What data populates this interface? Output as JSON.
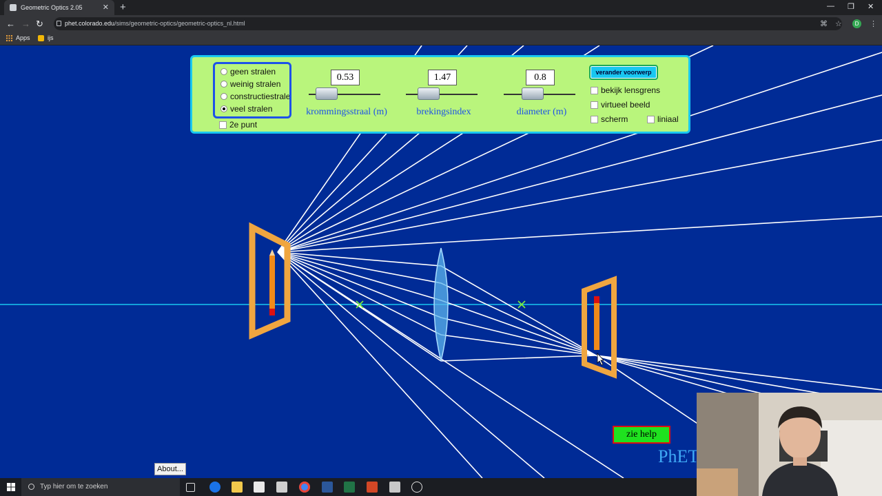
{
  "browser": {
    "tab_title": "Geometric Optics 2.05",
    "url_host": "phet.colorado.edu",
    "url_path": "/sims/geometric-optics/geometric-optics_nl.html",
    "bookmarks": [
      "Apps",
      "ijs"
    ],
    "profile_initial": "D"
  },
  "sim": {
    "ray_options": [
      "geen stralen",
      "weinig stralen",
      "constructiestralen",
      "veel stralen"
    ],
    "selected_ray_option": "veel stralen",
    "second_point_label": "2e punt",
    "sliders": [
      {
        "label": "krommingsstraal (m)",
        "value": "0.53",
        "level": 0.35
      },
      {
        "label": "brekingsindex",
        "value": "1.47",
        "level": 0.4
      },
      {
        "label": "diameter (m)",
        "value": "0.8",
        "level": 0.55
      }
    ],
    "change_object_label": "verander voorwerp",
    "checkboxes": [
      "bekijk lensgrens",
      "virtueel beeld",
      "scherm",
      "liniaal"
    ],
    "help_label": "zie help",
    "phet_label": "PhET",
    "about_label": "About..."
  },
  "taskbar": {
    "search_placeholder": "Typ hier om te zoeken"
  },
  "colors": {
    "sim_background": "#002b96",
    "panel_background": "#b9f57c",
    "panel_border": "#19c7f0",
    "axis": "#19c7f0",
    "rays": "#ffffff",
    "frame": "#f0a640",
    "help_button": "#1fe21f"
  }
}
